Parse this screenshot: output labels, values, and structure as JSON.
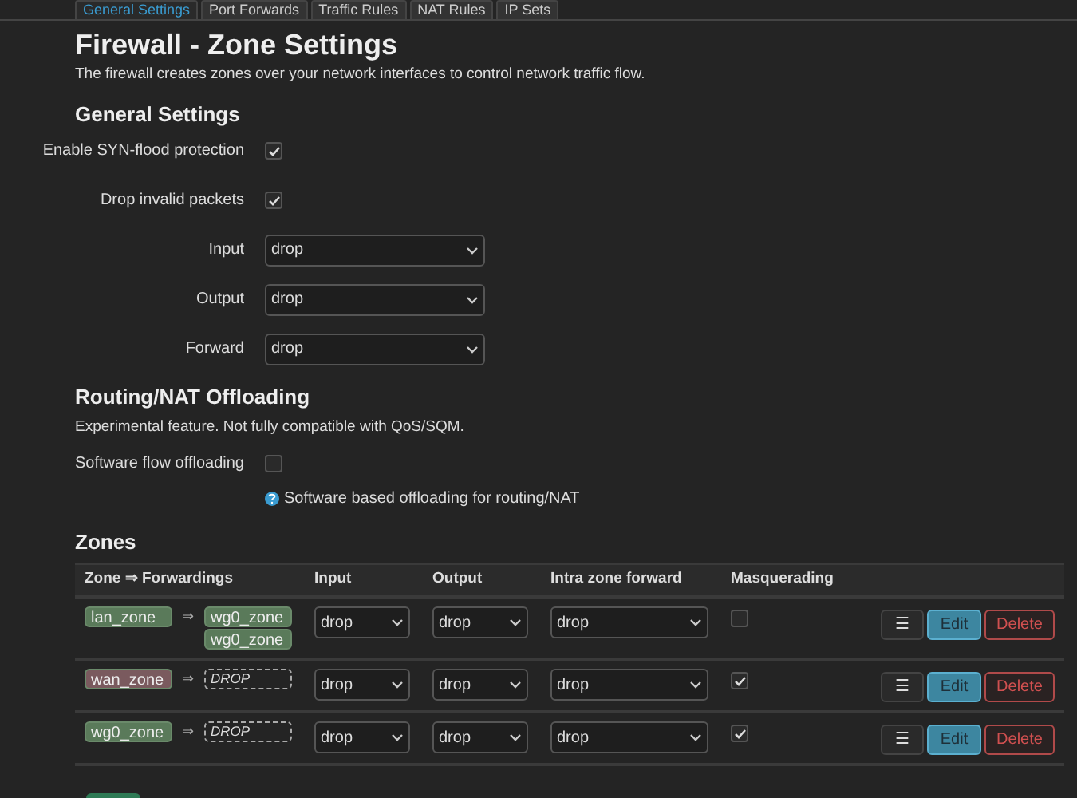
{
  "tabs": [
    {
      "label": "General Settings",
      "selected": true
    },
    {
      "label": "Port Forwards",
      "selected": false
    },
    {
      "label": "Traffic Rules",
      "selected": false
    },
    {
      "label": "NAT Rules",
      "selected": false
    },
    {
      "label": "IP Sets",
      "selected": false
    }
  ],
  "title": "Firewall - Zone Settings",
  "description": "The firewall creates zones over your network interfaces to control network traffic flow.",
  "general": {
    "heading": "General Settings",
    "fields": [
      {
        "kind": "checkbox",
        "label": "Enable SYN-flood protection",
        "checked": true
      },
      {
        "kind": "checkbox",
        "label": "Drop invalid packets",
        "checked": true
      },
      {
        "kind": "select",
        "label": "Input",
        "value": "drop"
      },
      {
        "kind": "select",
        "label": "Output",
        "value": "drop"
      },
      {
        "kind": "select",
        "label": "Forward",
        "value": "drop"
      }
    ]
  },
  "offloading": {
    "heading": "Routing/NAT Offloading",
    "note": "Experimental feature. Not fully compatible with QoS/SQM.",
    "fields": [
      {
        "kind": "checkbox",
        "label": "Software flow offloading",
        "checked": false,
        "help": "Software based offloading for routing/NAT"
      }
    ]
  },
  "zones": {
    "heading": "Zones",
    "columns": [
      "Zone ⇒ Forwardings",
      "Input",
      "Output",
      "Intra zone forward",
      "Masquerading"
    ],
    "rows": [
      {
        "zone": {
          "name": "lan_zone",
          "color": "#5a7a5a"
        },
        "arrow": "⇒",
        "forwards": [
          {
            "name": "wg0_zone",
            "color": "#5a7a5a"
          },
          {
            "name": "wg0_zone",
            "color": "#5a7a5a"
          }
        ],
        "input": "drop",
        "output": "drop",
        "intra": "drop",
        "masquerading": false,
        "actions": [
          "☰",
          "Edit",
          "Delete"
        ]
      },
      {
        "zone": {
          "name": "wan_zone",
          "color": "#7a5a5e"
        },
        "arrow": "⇒",
        "drop": "DROP",
        "input": "drop",
        "output": "drop",
        "intra": "drop",
        "masquerading": true,
        "actions": [
          "☰",
          "Edit",
          "Delete"
        ]
      },
      {
        "zone": {
          "name": "wg0_zone",
          "color": "#5a7a5a"
        },
        "arrow": "⇒",
        "drop": "DROP",
        "input": "drop",
        "output": "drop",
        "intra": "drop",
        "masquerading": true,
        "actions": [
          "☰",
          "Edit",
          "Delete"
        ]
      }
    ]
  }
}
